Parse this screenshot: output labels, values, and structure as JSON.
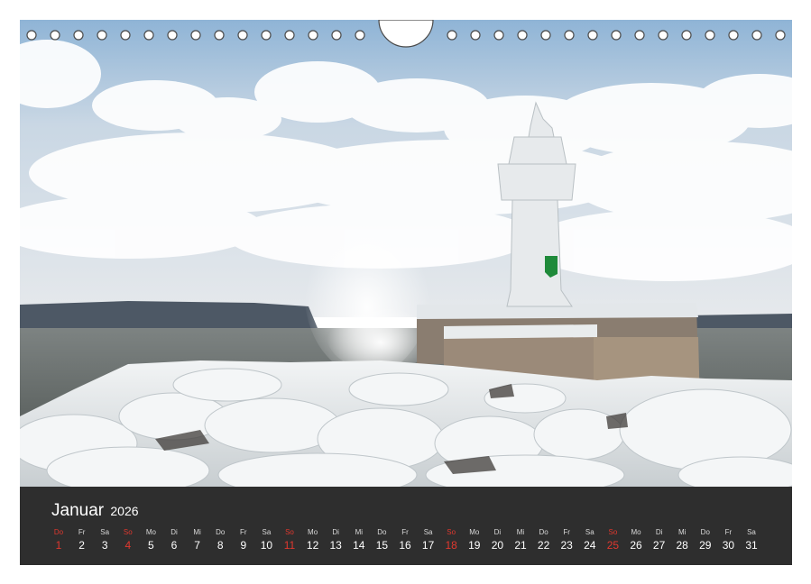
{
  "photo": {
    "subject": "frozen lighthouse on ice-covered pier with breaking wave"
  },
  "calendar": {
    "month": "Januar",
    "year": "2026",
    "days": [
      {
        "wd": "Do",
        "day": "1",
        "red": true
      },
      {
        "wd": "Fr",
        "day": "2",
        "red": false
      },
      {
        "wd": "Sa",
        "day": "3",
        "red": false
      },
      {
        "wd": "So",
        "day": "4",
        "red": true
      },
      {
        "wd": "Mo",
        "day": "5",
        "red": false
      },
      {
        "wd": "Di",
        "day": "6",
        "red": false
      },
      {
        "wd": "Mi",
        "day": "7",
        "red": false
      },
      {
        "wd": "Do",
        "day": "8",
        "red": false
      },
      {
        "wd": "Fr",
        "day": "9",
        "red": false
      },
      {
        "wd": "Sa",
        "day": "10",
        "red": false
      },
      {
        "wd": "So",
        "day": "11",
        "red": true
      },
      {
        "wd": "Mo",
        "day": "12",
        "red": false
      },
      {
        "wd": "Di",
        "day": "13",
        "red": false
      },
      {
        "wd": "Mi",
        "day": "14",
        "red": false
      },
      {
        "wd": "Do",
        "day": "15",
        "red": false
      },
      {
        "wd": "Fr",
        "day": "16",
        "red": false
      },
      {
        "wd": "Sa",
        "day": "17",
        "red": false
      },
      {
        "wd": "So",
        "day": "18",
        "red": true
      },
      {
        "wd": "Mo",
        "day": "19",
        "red": false
      },
      {
        "wd": "Di",
        "day": "20",
        "red": false
      },
      {
        "wd": "Mi",
        "day": "21",
        "red": false
      },
      {
        "wd": "Do",
        "day": "22",
        "red": false
      },
      {
        "wd": "Fr",
        "day": "23",
        "red": false
      },
      {
        "wd": "Sa",
        "day": "24",
        "red": false
      },
      {
        "wd": "So",
        "day": "25",
        "red": true
      },
      {
        "wd": "Mo",
        "day": "26",
        "red": false
      },
      {
        "wd": "Di",
        "day": "27",
        "red": false
      },
      {
        "wd": "Mi",
        "day": "28",
        "red": false
      },
      {
        "wd": "Do",
        "day": "29",
        "red": false
      },
      {
        "wd": "Fr",
        "day": "30",
        "red": false
      },
      {
        "wd": "Sa",
        "day": "31",
        "red": false
      }
    ]
  },
  "colors": {
    "bar_background": "#2e2e2e",
    "sunday_red": "#e0382e",
    "text_white": "#ffffff"
  }
}
